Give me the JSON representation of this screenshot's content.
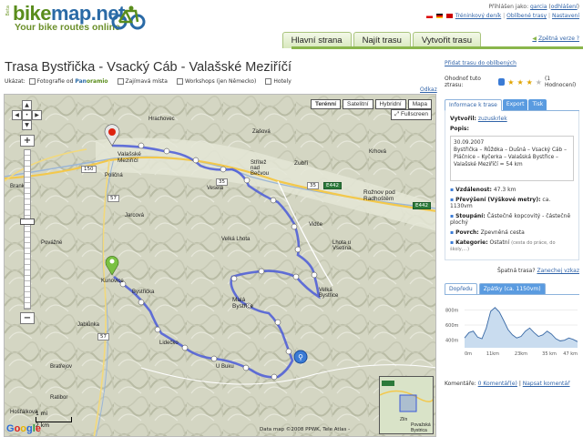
{
  "header": {
    "logo_small": "Beta",
    "logo_brand_1": "bike",
    "logo_brand_2": "map.net",
    "tagline": "Your bike routes online",
    "user_line_prefix": "Přihlášen jako:",
    "user_name": "garcia",
    "user_settings": "odhlášení",
    "link_training": "Tréninkový deník",
    "link_favorites": "Oblíbené trasy",
    "link_settings": "Nastavení",
    "nav": [
      "Hlavní strana",
      "Najít trasu",
      "Vytvořit trasu"
    ],
    "alt_version": "Zpětná verze ?"
  },
  "route": {
    "title": "Trasa Bystřička - Vsacký Cáb - Valašské Meziříčí",
    "show_label": "Ukázat:",
    "filters": [
      "Fotografie od",
      "Zajímavá místa",
      "Workshops (jen Německo)",
      "Hotely"
    ],
    "pano_a": "Pan",
    "pano_b": "oramio",
    "link_odkaz": "Odkaz"
  },
  "map": {
    "types": [
      "Terénní",
      "Satelitní",
      "Hybridní",
      "Mapa"
    ],
    "fullscreen": "Fullscreen",
    "scale_top": "1 mi",
    "scale_bottom": "2 km",
    "google": "Google",
    "copyright": "Data map ©2008 PPWK, Tele Atlas -",
    "places": {
      "valasske": "Valašské\nMeziříčí",
      "polom": "Poličná",
      "zubri": "Zubří",
      "zasova": "Zašová",
      "vesela": "Veselá",
      "roznov": "Rožnov pod\nRadhoštěm",
      "strani": "Střítež\nnad\nBečvou",
      "jarcova": "Jarcová",
      "vlhota": "Velká Lhota",
      "malab": "Malá\nBystřice",
      "vbys": "Velká\nBystřice",
      "bystricka": "Bystřička",
      "jablunka": "Jablůnka",
      "ratibor": "Ratibor",
      "kunovice": "Kunovice",
      "ubuku": "U Buku",
      "lidecko": "Lidečko",
      "hosta": "Hošťálková",
      "branky": "Branky",
      "zubri2": "Zubří",
      "krhova": "Krhová",
      "hrachovec": "Hrachovec",
      "vidce": "Vidče",
      "lhota2": "Lhota u\nVsetína",
      "povazne": "Povážné",
      "bratrejov": "Bratřejov",
      "zlin": "Zlín",
      "bystrice": "Považská\nBystrica"
    },
    "roads": [
      "35",
      "35",
      "E442",
      "57",
      "150",
      "57",
      "E442"
    ]
  },
  "side": {
    "fav_link": "Přidat trasu do oblíbených",
    "rate_label": "Ohodnoť tuto ztrasu:",
    "rating_count": "(1 Hodnocení)",
    "stars": 3,
    "tabs": [
      "Informace k trase",
      "Export",
      "Tisk"
    ],
    "created_label": "Vytvořil:",
    "created_by": "zuzuskrlek",
    "desc_label": "Popis:",
    "desc": "30.09.2007\nBystřička – Růždka – Dušná – Vsacký Cáb – Pláčnice – Kyčerka – Valašská Bystřice – Valašské Meziříčí = 54 km",
    "distance_label": "Vzdálenost:",
    "distance": "47.3 km",
    "elev_label": "Převýšení (Výškové metry):",
    "elev": "ca. 1130vm",
    "climb_label": "Stoupání:",
    "climb": "Částečně kopcovitý - částečně plochý",
    "surface_label": "Povrch:",
    "surface": "Zpevněná cesta",
    "cat_label": "Kategorie:",
    "cat": "Ostatní",
    "cat_note": "(cesta do práce, do školy,...)",
    "report_label": "Špatná trasa?",
    "report_link": "Zanechej vzkaz",
    "profile_tabs": [
      "Dopředu",
      "Zpátky (ca. 1150vm)"
    ],
    "profile_y_labels": [
      "800m",
      "600m",
      "400m"
    ],
    "profile_x_labels": [
      "0m",
      "11km",
      "23km",
      "35 km",
      "47 km"
    ],
    "profile_values": [
      430,
      500,
      520,
      440,
      420,
      560,
      780,
      830,
      770,
      660,
      540,
      470,
      430,
      450,
      520,
      560,
      500,
      450,
      470,
      520,
      480,
      420,
      390,
      400,
      430,
      410,
      380
    ],
    "comments_label": "Komentáře:",
    "comments_count": "0 Komentář(e)",
    "comments_link": "Napsat komentář"
  }
}
